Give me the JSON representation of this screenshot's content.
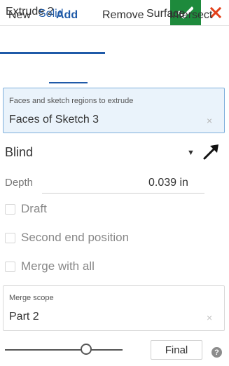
{
  "header": {
    "title": "Extrude 2",
    "ok_icon": "check-icon",
    "cancel_icon": "close-icon",
    "ok_color": "#1e8a3c",
    "cancel_color": "#e2401a"
  },
  "tabs": {
    "solid": "Solid",
    "surface": "Surface",
    "active": "Solid"
  },
  "operations": {
    "new": "New",
    "add": "Add",
    "remove": "Remove",
    "intersect": "Intersect",
    "active": "Add"
  },
  "faces": {
    "label": "Faces and sketch regions to extrude",
    "value": "Faces of Sketch 3",
    "clear_icon": "×"
  },
  "end_type": {
    "value": "Blind",
    "caret": "▼"
  },
  "depth": {
    "label": "Depth",
    "value": "0.039 in"
  },
  "checkboxes": {
    "draft": "Draft",
    "second_end": "Second end position",
    "merge_all": "Merge with all"
  },
  "merge_scope": {
    "label": "Merge scope",
    "value": "Part 2",
    "clear_icon": "×"
  },
  "footer": {
    "final_label": "Final",
    "help_icon": "?",
    "slider_level": 0.68
  },
  "colors": {
    "accent": "#1f5aa8",
    "selected_field_bg": "#eaf3fb"
  }
}
